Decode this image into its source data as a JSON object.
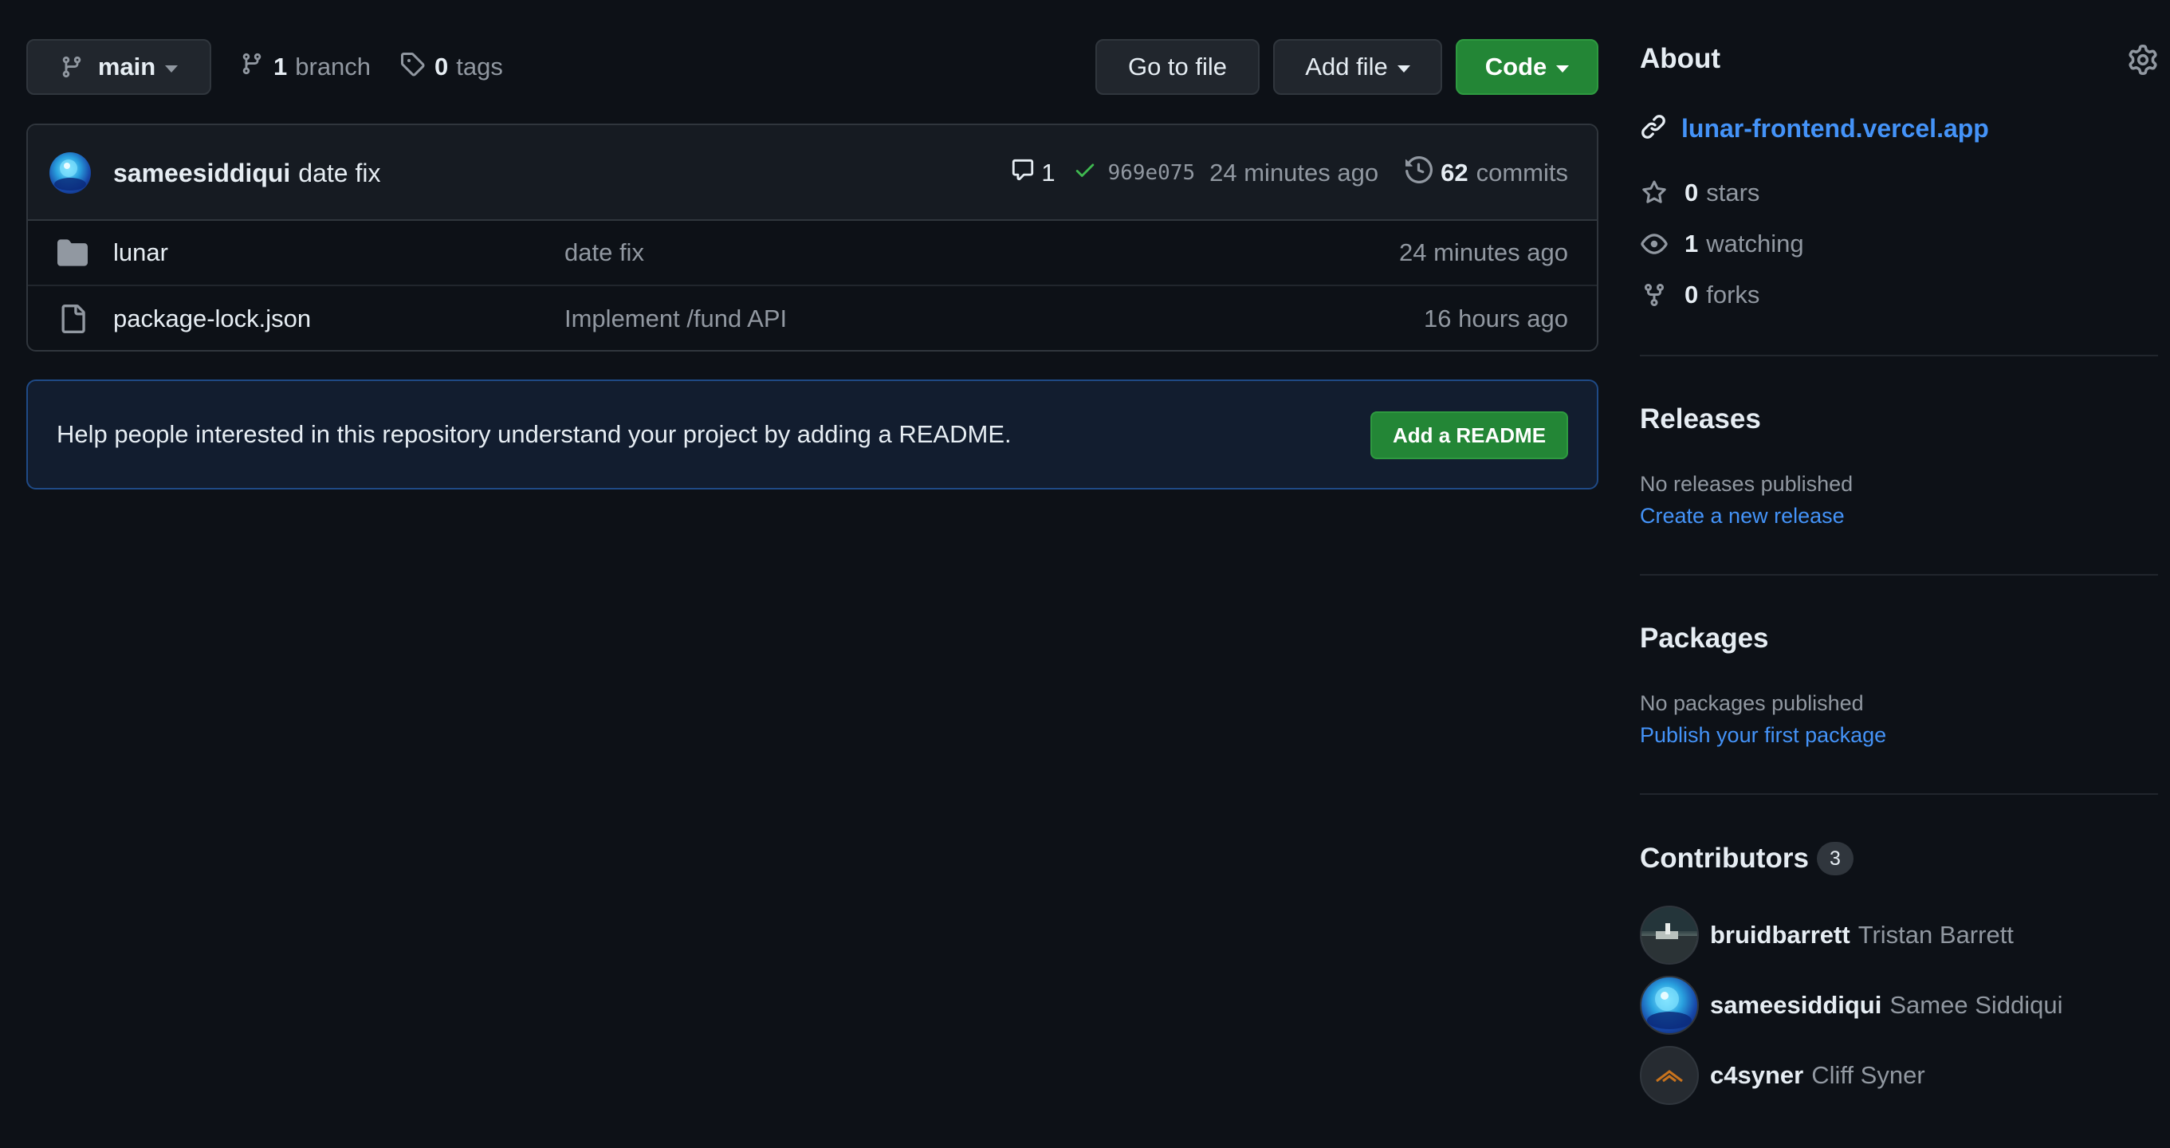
{
  "toolbar": {
    "branch_label": "main",
    "branch_count": "1",
    "branch_word": "branch",
    "tag_count": "0",
    "tag_word": "tags",
    "goto_label": "Go to file",
    "add_label": "Add file",
    "code_label": "Code"
  },
  "commit": {
    "author": "sameesiddiqui",
    "message": "date fix",
    "comment_count": "1",
    "sha": "969e075",
    "time": "24 minutes ago",
    "commit_count": "62",
    "commit_word": "commits"
  },
  "files": [
    {
      "type": "folder",
      "name": "lunar",
      "message": "date fix",
      "age": "24 minutes ago"
    },
    {
      "type": "file",
      "name": "package-lock.json",
      "message": "Implement /fund API",
      "age": "16 hours ago"
    }
  ],
  "readme": {
    "text": "Help people interested in this repository understand your project by adding a README.",
    "button": "Add a README"
  },
  "about": {
    "heading": "About",
    "website": "lunar-frontend.vercel.app",
    "stars_count": "0",
    "stars_word": "stars",
    "watching_count": "1",
    "watching_word": "watching",
    "forks_count": "0",
    "forks_word": "forks"
  },
  "releases": {
    "heading": "Releases",
    "empty": "No releases published",
    "link": "Create a new release"
  },
  "packages": {
    "heading": "Packages",
    "empty": "No packages published",
    "link": "Publish your first package"
  },
  "contributors": {
    "heading": "Contributors",
    "count": "3",
    "people": [
      {
        "login": "bruidbarrett",
        "name": "Tristan Barrett"
      },
      {
        "login": "sameesiddiqui",
        "name": "Samee Siddiqui"
      },
      {
        "login": "c4syner",
        "name": "Cliff Syner"
      }
    ]
  },
  "colors": {
    "background": "#0d1117",
    "accent_link": "#4493f8",
    "primary_button": "#238636",
    "success_check": "#3fb950"
  }
}
